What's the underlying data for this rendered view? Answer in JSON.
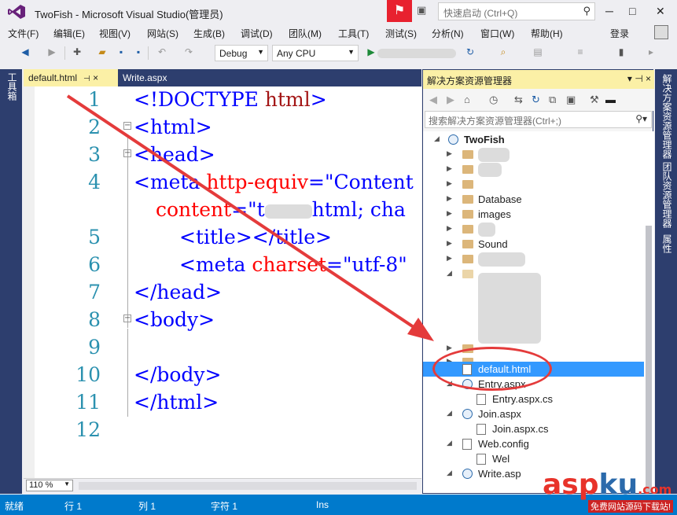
{
  "window": {
    "title": "TwoFish - Microsoft Visual Studio(管理员)",
    "quick_launch_placeholder": "快速启动 (Ctrl+Q)"
  },
  "menu": [
    "文件(F)",
    "编辑(E)",
    "视图(V)",
    "网站(S)",
    "生成(B)",
    "调试(D)",
    "团队(M)",
    "工具(T)",
    "测试(S)",
    "分析(N)",
    "窗口(W)",
    "帮助(H)"
  ],
  "login": "登录",
  "toolbar": {
    "config": "Debug",
    "platform": "Any CPU"
  },
  "left_panel": "工具箱",
  "tabs": [
    {
      "label": "default.html",
      "pin": "⊣",
      "close": "×"
    },
    {
      "label": "Write.aspx"
    }
  ],
  "editor": {
    "zoom": "110 %",
    "line_numbers": [
      "1",
      "2",
      "3",
      "4",
      "",
      "5",
      "6",
      "7",
      "8",
      "9",
      "10",
      "11",
      "12"
    ],
    "lines": [
      [
        "<!DOCTYPE ",
        "html",
        ">"
      ],
      [
        "<html>"
      ],
      [
        "<head>"
      ],
      [
        "<meta ",
        "http-equiv",
        "=\"Content"
      ],
      [
        "content",
        "=\"",
        "t",
        "html; cha"
      ],
      [
        "<title></title>"
      ],
      [
        "<meta ",
        "charset",
        "=\"utf-8\""
      ],
      [
        "</head>"
      ],
      [
        "<body>"
      ],
      [
        ""
      ],
      [
        "</body>"
      ],
      [
        "</html>"
      ],
      [
        ""
      ]
    ]
  },
  "solution_explorer": {
    "title": "解决方案资源管理器",
    "search_placeholder": "搜索解决方案资源管理器(Ctrl+;)",
    "root": "TwoFish",
    "items": [
      "Database",
      "images",
      "Sound",
      "default.html",
      "Entry.aspx",
      "Entry.aspx.cs",
      "Join.aspx",
      "Join.aspx.cs",
      "Web.config",
      "Wel",
      "Write.asp"
    ]
  },
  "right_panel": [
    "解决方案资源管理器",
    "团队资源管理器",
    "属性"
  ],
  "status": {
    "ready": "就绪",
    "row": "行 1",
    "col": "列 1",
    "char": "字符 1",
    "ins": "Ins"
  },
  "watermark": {
    "main": "asp",
    "accent": "ku",
    "suffix": ".com",
    "sub": "免费网站源码下载站!"
  }
}
